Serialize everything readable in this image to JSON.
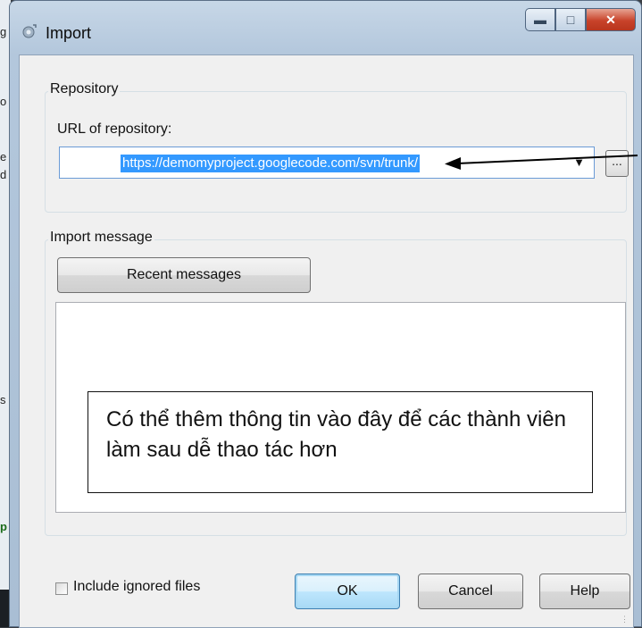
{
  "window": {
    "title": "Import"
  },
  "repository": {
    "group_label": "Repository",
    "url_label": "URL of repository:",
    "url_value": "https://demomyproject.googlecode.com/svn/trunk/",
    "browse_label": "..."
  },
  "import_message": {
    "group_label": "Import message",
    "recent_button": "Recent messages"
  },
  "annotation": {
    "note_text": "Có thể thêm thông tin vào đây để các thành viên làm sau dễ thao tác hơn"
  },
  "footer": {
    "include_ignored_label": "Include ignored files",
    "include_ignored_checked": false,
    "ok_label": "OK",
    "cancel_label": "Cancel",
    "help_label": "Help"
  },
  "background_fragments": [
    "g",
    "o",
    "e",
    "d",
    "s",
    "p"
  ]
}
